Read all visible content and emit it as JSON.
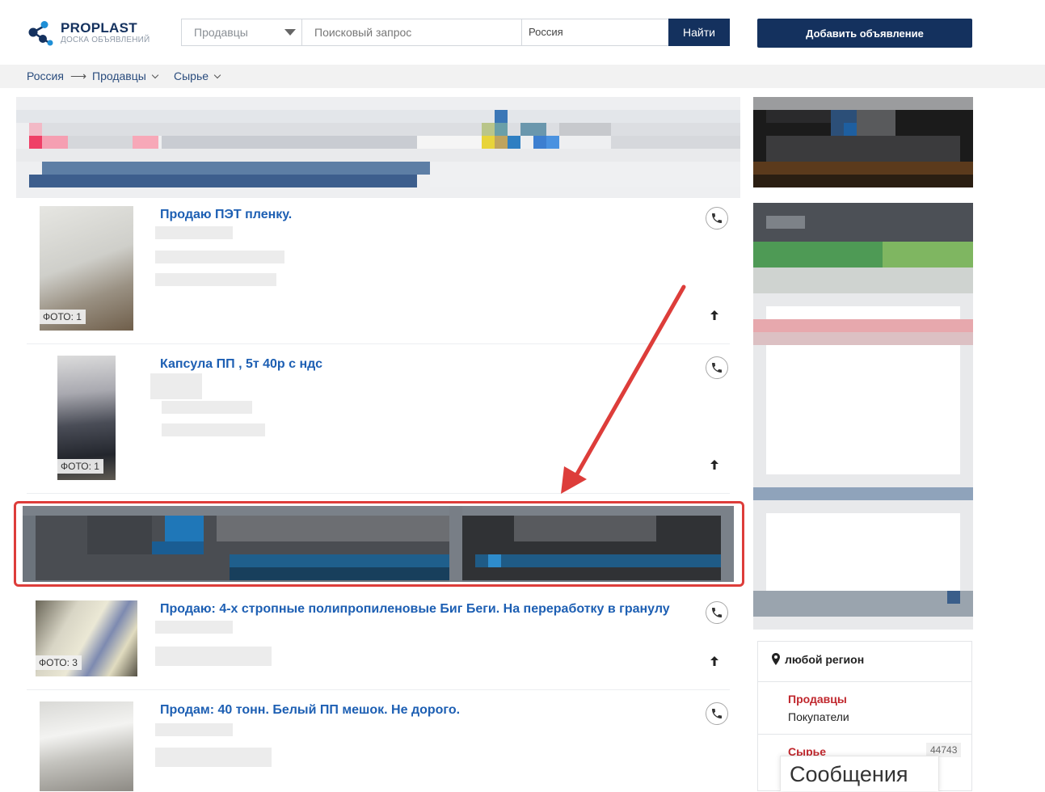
{
  "header": {
    "logo_title": "PROPLAST",
    "logo_subtitle": "ДОСКА ОБЪЯВЛЕНИЙ",
    "category_select": "Продавцы",
    "search_placeholder": "Поисковый запрос",
    "region": "Россия",
    "find_button": "Найти",
    "add_button": "Добавить объявление"
  },
  "breadcrumb": {
    "root": "Россия",
    "arrow": "⟶",
    "level1": "Продавцы",
    "level2": "Сырье"
  },
  "listings": [
    {
      "title": "Продаю ПЭТ пленку.",
      "photos": "ФОТО: 1"
    },
    {
      "title": "Капсула ПП , 5т 40р с ндс",
      "photos": "ФОТО: 1"
    },
    {
      "title": "Продаю: 4-х стропные полипропиленовые Биг Беги. На переработку в гранулу",
      "photos": "ФОТО: 3"
    },
    {
      "title": "Продам: 40 тонн. Белый ПП мешок. Не дорого.",
      "photos": ""
    }
  ],
  "sidebar": {
    "region_label": "любой регион",
    "type_active": "Продавцы",
    "type_other": "Покупатели",
    "category_label": "Сырье",
    "category_count": "44743"
  },
  "messages_label": "Сообщения",
  "colors": {
    "brand": "#14315e",
    "link": "#1d5fb3",
    "active_filter": "#c0272d",
    "highlight": "#dd3d3a"
  }
}
